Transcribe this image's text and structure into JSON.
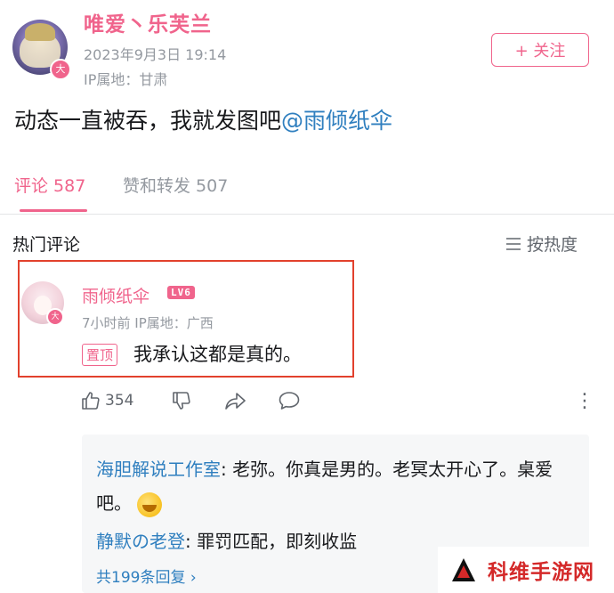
{
  "post": {
    "author": "唯爱丶乐芙兰",
    "time": "2023年9月3日 19:14",
    "ip": "IP属地：甘肃",
    "avatar_badge": "大",
    "follow_label": "+ 关注",
    "text": "动态一直被吞，我就发图吧",
    "mention": "@雨倾纸伞"
  },
  "tabs": {
    "comments": "评论 587",
    "likes_reposts": "赞和转发 507"
  },
  "section": {
    "hot_label": "热门评论",
    "sort_label": "按热度"
  },
  "comment": {
    "name": "雨倾纸伞",
    "level": "LV6",
    "avatar_badge": "大",
    "meta": "7小时前  IP属地：广西",
    "pin": "置顶",
    "text": "我承认这都是真的。",
    "likes": "354"
  },
  "replies": [
    {
      "name": "海胆解说工作室",
      "text": ": 老弥。你真是男的。老冥太开心了。桌爱吧。"
    },
    {
      "name": "静默の老登",
      "text": ": 罪罚匹配，即刻收监"
    }
  ],
  "more_replies": "共199条回复 ›",
  "watermark": "科维手游网",
  "colors": {
    "accent": "#f0648c",
    "link": "#2f7fbf",
    "highlight_box": "#e2412d"
  }
}
